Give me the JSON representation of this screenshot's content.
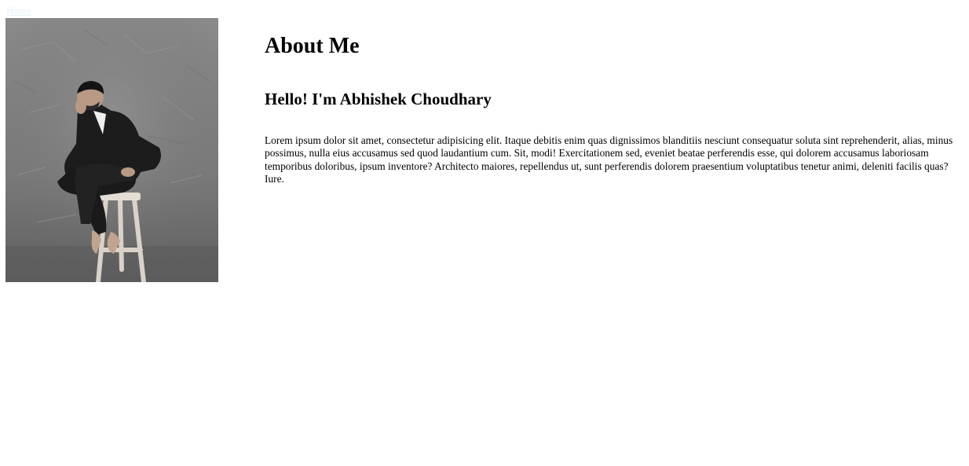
{
  "nav": {
    "home_label": "Home"
  },
  "profile": {
    "photo_icon": "portrait-photo",
    "heading": "About Me",
    "greeting": "Hello! I'm Abhishek Choudhary",
    "bio": "Lorem ipsum dolor sit amet, consectetur adipisicing elit. Itaque debitis enim quas dignissimos blanditiis nesciunt consequatur soluta sint reprehenderit, alias, minus possimus, nulla eius accusamus sed quod laudantium cum. Sit, modi! Exercitationem sed, eveniet beatae perferendis esse, qui dolorem accusamus laboriosam temporibus doloribus, ipsum inventore? Architecto maiores, repellendus ut, sunt perferendis dolorem praesentium voluptatibus tenetur animi, deleniti facilis quas? Iure."
  },
  "colors": {
    "background": "#ffffff",
    "text": "#000000",
    "home_link": "#e6f2f7"
  }
}
